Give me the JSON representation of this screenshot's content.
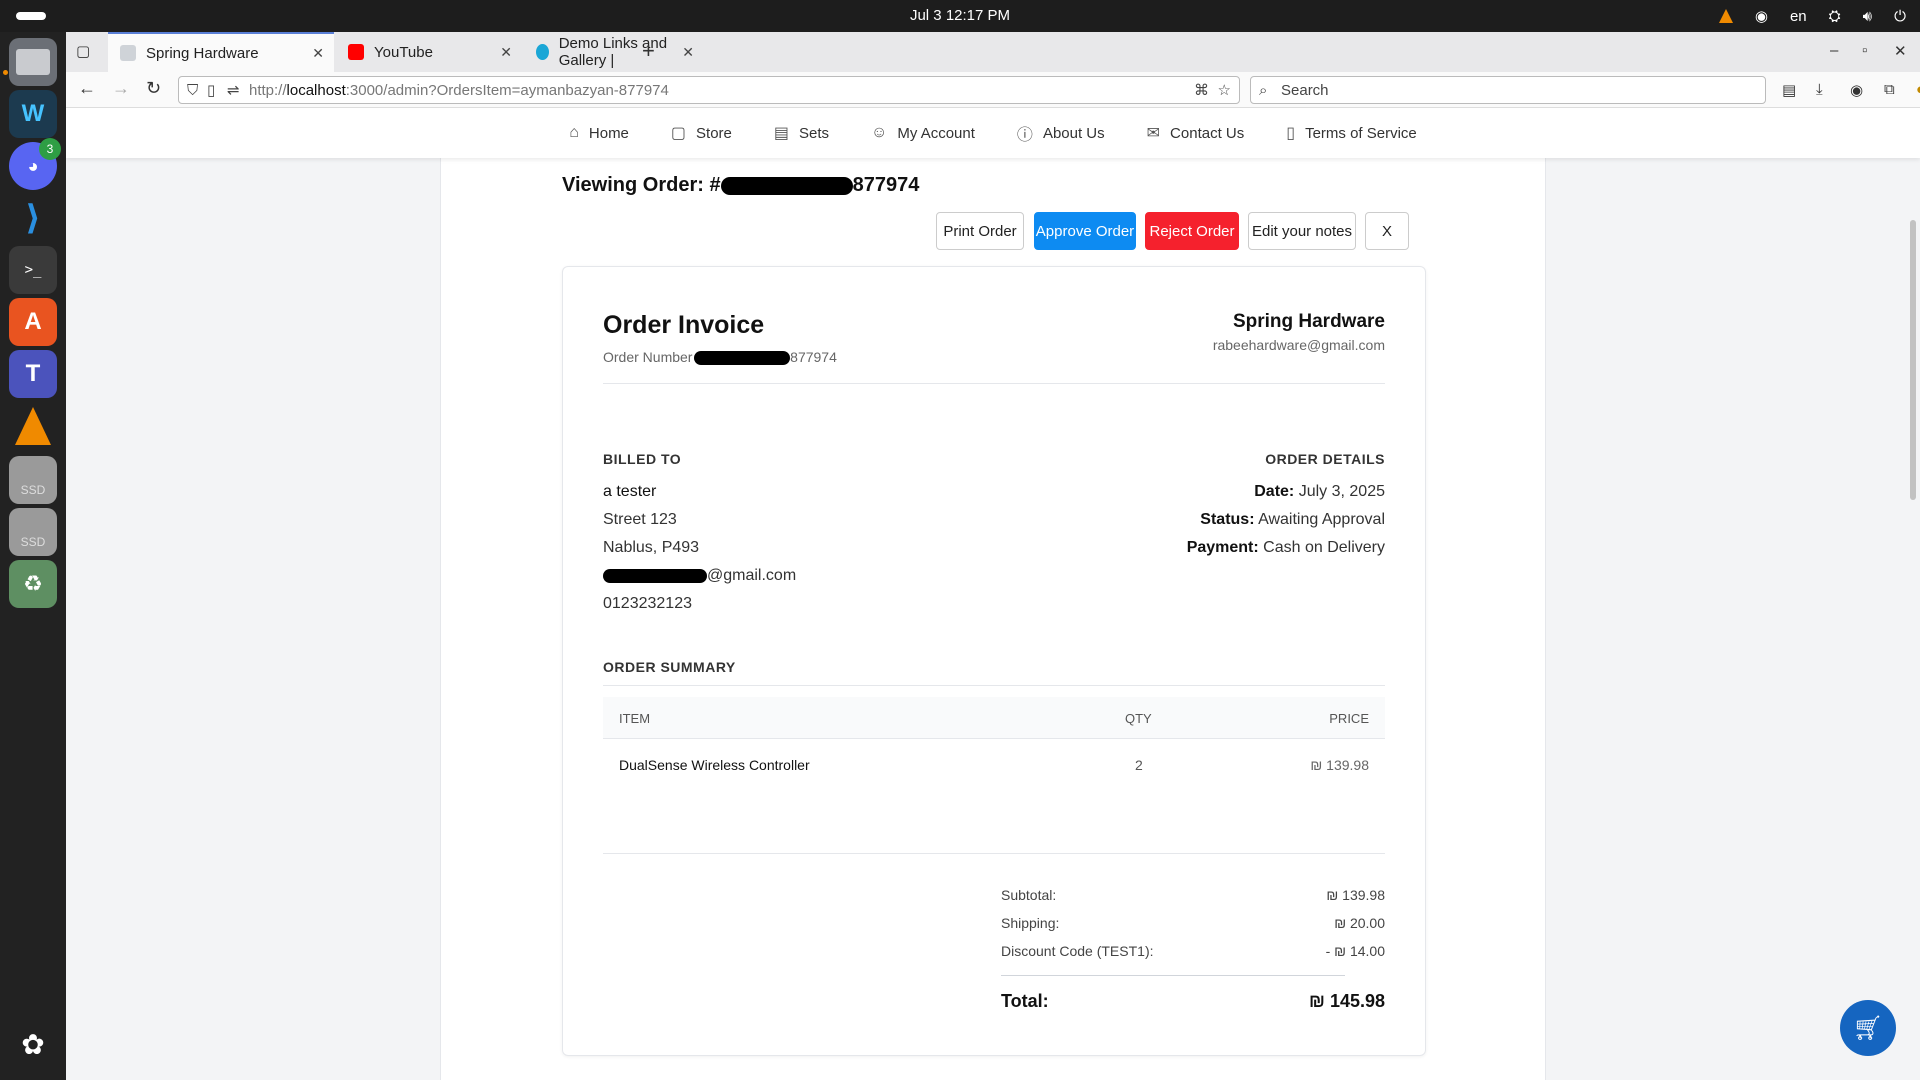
{
  "system": {
    "clock": "Jul 3  12:17 PM",
    "lang": "en",
    "discord_badge": "3"
  },
  "browser": {
    "tabs": [
      {
        "label": "Spring Hardware",
        "active": true
      },
      {
        "label": "YouTube",
        "active": false
      },
      {
        "label": "Demo Links and Gallery |",
        "active": false
      }
    ],
    "url_prefix": "http://",
    "url_host": "localhost",
    "url_rest": ":3000/admin?OrdersItem=aymanbazyan-877974",
    "search_placeholder": "Search"
  },
  "site_nav": [
    {
      "label": "Home",
      "icon": "home-icon"
    },
    {
      "label": "Store",
      "icon": "bag-icon"
    },
    {
      "label": "Sets",
      "icon": "list-icon"
    },
    {
      "label": "My Account",
      "icon": "user-icon"
    },
    {
      "label": "About Us",
      "icon": "info-icon"
    },
    {
      "label": "Contact Us",
      "icon": "mail-icon"
    },
    {
      "label": "Terms of Service",
      "icon": "document-icon"
    }
  ],
  "order": {
    "viewing_prefix": "Viewing Order: #",
    "viewing_suffix": "877974",
    "actions": {
      "print": "Print Order",
      "approve": "Approve Order",
      "reject": "Reject Order",
      "notes": "Edit your notes",
      "close": "X"
    }
  },
  "invoice": {
    "title": "Order Invoice",
    "number_prefix": "Order Number #",
    "number_suffix": "877974",
    "store_name": "Spring Hardware",
    "store_email": "rabeehardware@gmail.com",
    "billed_to_heading": "BILLED TO",
    "billed": {
      "name": "a tester",
      "street": "Street 123",
      "city": "Nablus, P493",
      "email_suffix": "@gmail.com",
      "phone": "0123232123"
    },
    "details_heading": "ORDER DETAILS",
    "details": {
      "date_label": "Date:",
      "date": "July 3, 2025",
      "status_label": "Status:",
      "status": "Awaiting Approval",
      "payment_label": "Payment:",
      "payment": "Cash on Delivery"
    },
    "summary_heading": "ORDER SUMMARY",
    "columns": {
      "item": "ITEM",
      "qty": "QTY",
      "price": "PRICE"
    },
    "items": [
      {
        "name": "DualSense Wireless Controller",
        "qty": "2",
        "price": "₪ 139.98"
      }
    ],
    "totals": {
      "subtotal_label": "Subtotal:",
      "subtotal": "₪ 139.98",
      "shipping_label": "Shipping:",
      "shipping": "₪ 20.00",
      "discount_label": "Discount Code (TEST1):",
      "discount": "- ₪ 14.00",
      "total_label": "Total:",
      "total": "₪ 145.98"
    }
  },
  "colors": {
    "approve": "#0d8bf2",
    "reject": "#f5212d",
    "cart_fab": "#1565c0"
  }
}
